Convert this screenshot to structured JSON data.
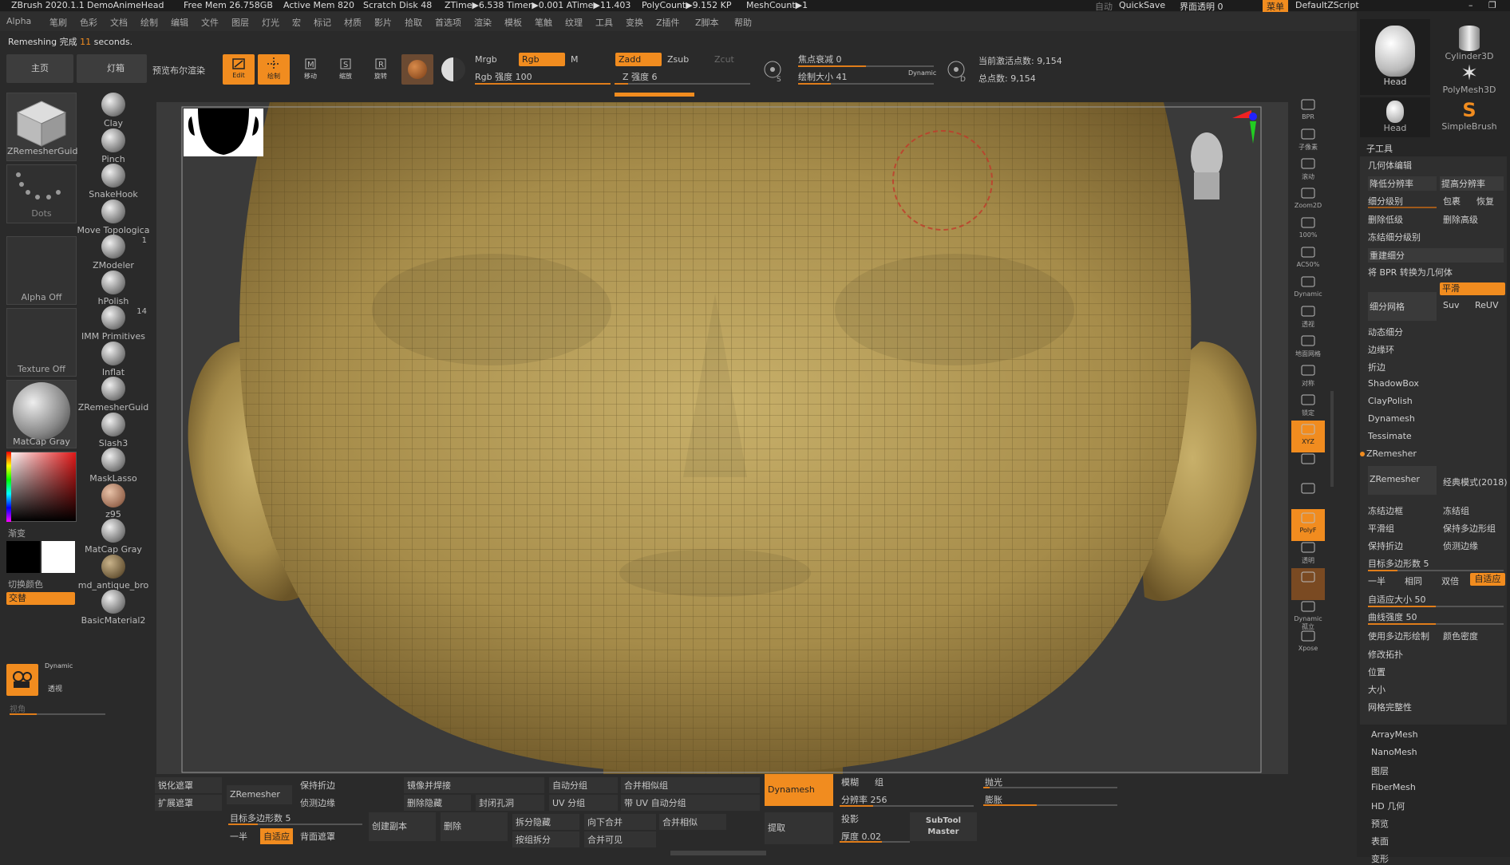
{
  "titlebar": {
    "app": "ZBrush 2020.1.1",
    "doc": "DemoAnimeHead",
    "free_mem": "Free Mem 26.758GB",
    "active_mem": "Active Mem 820",
    "scratch": "Scratch Disk 48",
    "ztime": "ZTime▶6.538 Timer▶0.001 ATime▶11.403",
    "polycount": "PolyCount▶9.152 KP",
    "meshcount": "MeshCount▶1",
    "auto": "自动",
    "quicksave": "QuickSave",
    "ui_trans": "界面透明 0",
    "menu_btn": "菜单",
    "script": "DefaultZScript"
  },
  "menubar": [
    "Alpha",
    "笔刷",
    "色彩",
    "文档",
    "绘制",
    "编辑",
    "文件",
    "图层",
    "灯光",
    "宏",
    "标记",
    "材质",
    "影片",
    "拾取",
    "首选项",
    "渲染",
    "模板",
    "笔触",
    "纹理",
    "工具",
    "变换",
    "Z插件",
    "Z脚本",
    "帮助"
  ],
  "status": {
    "prefix": "Remeshing 完成 ",
    "seconds": "11",
    "suffix": " seconds."
  },
  "toolbar": {
    "home": "主页",
    "lightbox": "灯箱",
    "preview_render": "预览布尔渲染",
    "edit": "Edit",
    "draw": "绘制",
    "move": "移动",
    "scale": "缩放",
    "rotate": "旋转",
    "mrgb": "Mrgb",
    "rgb": "Rgb",
    "m": "M",
    "rgb_intensity": "Rgb 强度 100",
    "rgb_intensity_value": 100,
    "zadd": "Zadd",
    "zsub": "Zsub",
    "zcut": "Zcut",
    "z_intensity": "Z 强度 6",
    "z_intensity_value": 6,
    "focal_shift": "焦点衰减 0",
    "draw_size": "绘制大小 41",
    "dynamic": "Dynamic",
    "active_points": "当前激活点数: 9,154",
    "total_points": "总点数: 9,154"
  },
  "left_shelf": {
    "zremesher_guide": "ZRemesherGuid",
    "dots": "Dots",
    "alpha_off": "Alpha Off",
    "texture_off": "Texture Off",
    "matcap_gray": "MatCap Gray",
    "gradient": "渐变",
    "switch_color": "切换颜色",
    "alternate": "交替",
    "brushes": [
      {
        "label": "Clay",
        "count": ""
      },
      {
        "label": "Pinch",
        "count": ""
      },
      {
        "label": "SnakeHook",
        "count": ""
      },
      {
        "label": "Move Topologica",
        "count": ""
      },
      {
        "label": "ZModeler",
        "count": "1"
      },
      {
        "label": "hPolish",
        "count": ""
      },
      {
        "label": "IMM Primitives",
        "count": "14"
      },
      {
        "label": "Inflat",
        "count": ""
      },
      {
        "label": "ZRemesherGuid",
        "count": ""
      },
      {
        "label": "Slash3",
        "count": ""
      },
      {
        "label": "MaskLasso",
        "count": ""
      },
      {
        "label": "z95",
        "count": ""
      },
      {
        "label": "MatCap Gray",
        "count": ""
      },
      {
        "label": "md_antique_bro",
        "count": ""
      },
      {
        "label": "BasicMaterial2",
        "count": ""
      }
    ],
    "dynamic": "Dynamic",
    "perspective": "透视",
    "fov": "视角"
  },
  "right_shelf": [
    "BPR",
    "子像素",
    "滚动",
    "Zoom2D",
    "100%",
    "AC50%",
    "Dynamic",
    "透视",
    "地面网格",
    "对称",
    "锁定",
    "XYZ",
    "",
    "",
    "PolyF",
    "透明",
    "",
    "Dynamic 孤立",
    "Xpose"
  ],
  "tool_panel": {
    "thumbs": [
      "Head",
      "Cylinder3D",
      "PolyMesh3D",
      "Head",
      "SimpleBrush"
    ],
    "subtool": "子工具",
    "geometry": "几何体编辑",
    "lower_res": "降低分辨率",
    "higher_res": "提高分辨率",
    "sdiv": "细分级别",
    "cage": "包裹",
    "rstr": "恢复",
    "del_lower": "删除低级",
    "del_higher": "删除高级",
    "freeze_sub": "冻结细分级别",
    "reconstruct": "重建细分",
    "convert_bpr": "将 BPR 转换为几何体",
    "divide": "细分网格",
    "smooth": "平滑",
    "suv": "Suv",
    "reuv": "ReUV",
    "dynamic_sub": "动态细分",
    "edge_loop": "边缘环",
    "crease": "折边",
    "shadowbox": "ShadowBox",
    "claypolish": "ClayPolish",
    "dynamesh": "Dynamesh",
    "tessimate": "Tessimate",
    "zremesher_section": "ZRemesher",
    "zremesher_btn": "ZRemesher",
    "legacy": "经典模式(2018)",
    "freeze_border": "冻结边框",
    "freeze_groups": "冻结组",
    "smooth_groups": "平滑组",
    "keep_groups": "保持多边形组",
    "keep_creases": "保持折边",
    "detect_edges": "侦测边缘",
    "target_count": "目标多边形数 5",
    "half": "一半",
    "same": "相同",
    "double": "双倍",
    "adaptive": "自适应",
    "adaptive_size": "自适应大小 50",
    "curve_strength": "曲线强度 50",
    "use_polypaint": "使用多边形绘制",
    "color_density": "颜色密度",
    "modify_topo": "修改拓扑",
    "position": "位置",
    "size": "大小",
    "mesh_integrity": "网格完整性",
    "arraymesh": "ArrayMesh",
    "nanomesh": "NanoMesh",
    "layers": "图层",
    "fibermesh": "FiberMesh",
    "hd_geometry": "HD 几何",
    "preview": "预览",
    "surface": "表面",
    "deformation": "变形"
  },
  "bottom": {
    "sharpen_mask": "锐化遮罩",
    "grow_mask": "扩展遮罩",
    "zremesher": "ZRemesher",
    "keep_creases": "保持折边",
    "detect_edges": "侦测边缘",
    "target_count": "目标多边形数 5",
    "half": "一半",
    "adaptive": "自适应",
    "backface_mask": "背面遮罩",
    "mirror_weld": "镜像并焊接",
    "del_hidden": "删除隐藏",
    "close_holes": "封闭孔洞",
    "create_dup": "创建副本",
    "delete": "删除",
    "split_hidden": "拆分隐藏",
    "groups_split": "按组拆分",
    "auto_groups": "自动分组",
    "uv_groups": "UV 分组",
    "merge_down": "向下合并",
    "merge_visible": "合并可见",
    "merge_similar_groups": "合并相似组",
    "auto_uv_groups": "带 UV 自动分组",
    "merge_similar": "合并相似",
    "dynamesh": "Dynamesh",
    "blur": "模糊",
    "groups": "组",
    "resolution": "分辨率 256",
    "project": "投影",
    "extract": "提取",
    "thickness": "厚度 0.02",
    "subtool_master": "SubTool Master",
    "polish": "抛光",
    "bulge": "膨胀"
  },
  "colors": {
    "accent": "#f18c1f",
    "background": "#2a2a2a",
    "mesh": "#bda45f"
  }
}
